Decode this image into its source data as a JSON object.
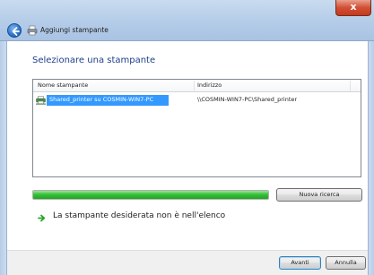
{
  "window": {
    "title": "Aggiungi stampante",
    "close_label": "x"
  },
  "page": {
    "heading": "Selezionare una stampante"
  },
  "printer_list": {
    "columns": [
      "Nome stampante",
      "Indirizzo"
    ],
    "rows": [
      {
        "name": "Shared_printer su COSMIN-WIN7-PC",
        "address": "\\\\COSMIN-WIN7-PC\\Shared_printer",
        "selected": true
      }
    ]
  },
  "search": {
    "progress": 1.0,
    "button_label": "Nuova ricerca"
  },
  "link": {
    "label": "La stampante desiderata non è nell'elenco"
  },
  "footer": {
    "next_label": "Avanti",
    "cancel_label": "Annulla"
  },
  "colors": {
    "heading": "#1e3f8a",
    "selection": "#3399ff",
    "progress": "#37c13a",
    "link_arrow": "#2aa52d"
  },
  "icons": {
    "back": "back-arrow-icon",
    "title": "printer-icon",
    "row": "network-printer-icon",
    "link": "green-arrow-icon"
  }
}
